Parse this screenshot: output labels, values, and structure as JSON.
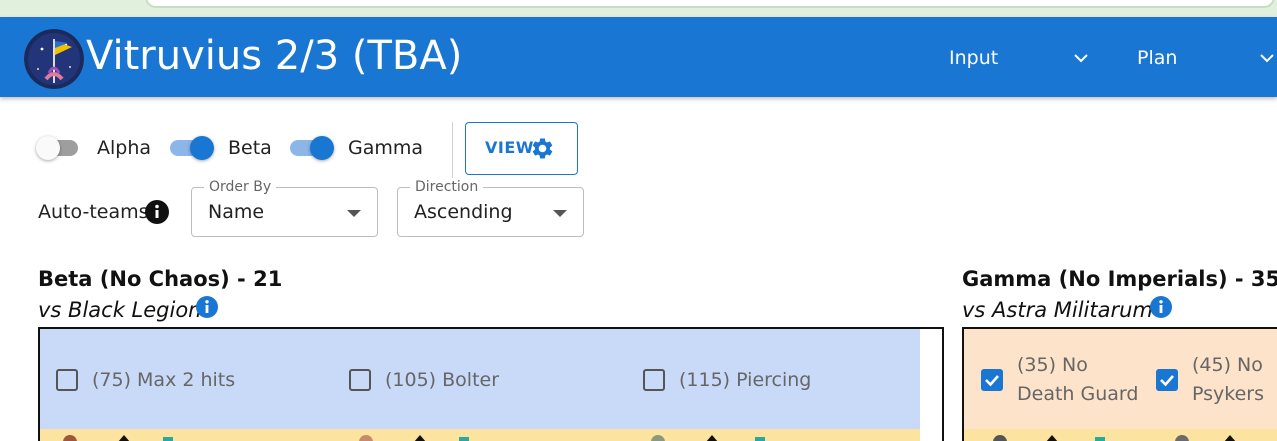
{
  "app": {
    "title": "Vitruvius 2/3 (TBA)"
  },
  "nav": [
    {
      "label": "Input"
    },
    {
      "label": "Plan"
    }
  ],
  "toggles": [
    {
      "label": "Alpha",
      "on": false
    },
    {
      "label": "Beta",
      "on": true
    },
    {
      "label": "Gamma",
      "on": true
    }
  ],
  "view_button": {
    "label": "VIEW",
    "icon": "gear-icon"
  },
  "auto_teams": {
    "label": "Auto-teams",
    "icon": "info-icon"
  },
  "order_by": {
    "legend": "Order By",
    "value": "Name"
  },
  "direction": {
    "legend": "Direction",
    "value": "Ascending"
  },
  "teams": [
    {
      "title": "Beta (No Chaos) - 21",
      "vs": "vs Black Legion",
      "filters": [
        {
          "label": "(75) Max 2 hits",
          "checked": false
        },
        {
          "label": "(105) Bolter",
          "checked": false
        },
        {
          "label": "(115) Piercing",
          "checked": false
        }
      ]
    },
    {
      "title": "Gamma (No Imperials) - 35",
      "vs": "vs Astra Militarum",
      "filters": [
        {
          "label_line1": "(35) No",
          "label_line2": "Death Guard",
          "checked": true
        },
        {
          "label_line1": "(45) No",
          "label_line2": "Psykers",
          "checked": true
        }
      ]
    }
  ],
  "colors": {
    "appbar": "#1976d2",
    "accent": "#1976d2",
    "beta_panel": "#c9daf8",
    "gamma_panel": "#fde3c9",
    "strip": "#fce3a0"
  }
}
